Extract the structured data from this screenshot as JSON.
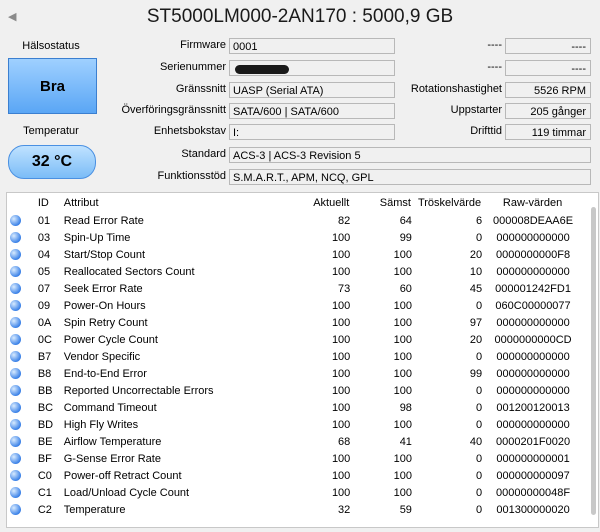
{
  "header": {
    "title": "ST5000LM000-2AN170 : 5000,9 GB",
    "prev_glyph": "◀"
  },
  "health": {
    "label": "Hälsostatus",
    "value": "Bra"
  },
  "temperature": {
    "label": "Temperatur",
    "value": "32 °C"
  },
  "fields": {
    "firmware": {
      "label": "Firmware",
      "value": "0001"
    },
    "serial": {
      "label": "Serienummer",
      "value": ""
    },
    "interface": {
      "label": "Gränssnitt",
      "value": "UASP (Serial ATA)"
    },
    "transfer": {
      "label": "Överföringsgränssnitt",
      "value": "SATA/600 | SATA/600"
    },
    "drive_letter": {
      "label": "Enhetsbokstav",
      "value": "I:"
    },
    "standard": {
      "label": "Standard",
      "value": "ACS-3 | ACS-3 Revision 5"
    },
    "features": {
      "label": "Funktionsstöd",
      "value": "S.M.A.R.T., APM, NCQ, GPL"
    }
  },
  "right_fields": {
    "blank1": {
      "label": "----",
      "value": "----"
    },
    "blank2": {
      "label": "----",
      "value": "----"
    },
    "rotation": {
      "label": "Rotationshastighet",
      "value": "5526 RPM"
    },
    "power_on_count": {
      "label": "Uppstarter",
      "value": "205 gånger"
    },
    "power_on_hours": {
      "label": "Drifttid",
      "value": "119 timmar"
    }
  },
  "table": {
    "headers": [
      "",
      "ID",
      "Attribut",
      "Aktuellt",
      "Sämst",
      "Tröskelvärde",
      "Raw-värden"
    ],
    "rows": [
      [
        "01",
        "Read Error Rate",
        "82",
        "64",
        "6",
        "000008DEAA6E"
      ],
      [
        "03",
        "Spin-Up Time",
        "100",
        "99",
        "0",
        "000000000000"
      ],
      [
        "04",
        "Start/Stop Count",
        "100",
        "100",
        "20",
        "0000000000F8"
      ],
      [
        "05",
        "Reallocated Sectors Count",
        "100",
        "100",
        "10",
        "000000000000"
      ],
      [
        "07",
        "Seek Error Rate",
        "73",
        "60",
        "45",
        "000001242FD1"
      ],
      [
        "09",
        "Power-On Hours",
        "100",
        "100",
        "0",
        "060C00000077"
      ],
      [
        "0A",
        "Spin Retry Count",
        "100",
        "100",
        "97",
        "000000000000"
      ],
      [
        "0C",
        "Power Cycle Count",
        "100",
        "100",
        "20",
        "0000000000CD"
      ],
      [
        "B7",
        "Vendor Specific",
        "100",
        "100",
        "0",
        "000000000000"
      ],
      [
        "B8",
        "End-to-End Error",
        "100",
        "100",
        "99",
        "000000000000"
      ],
      [
        "BB",
        "Reported Uncorrectable Errors",
        "100",
        "100",
        "0",
        "000000000000"
      ],
      [
        "BC",
        "Command Timeout",
        "100",
        "98",
        "0",
        "001200120013"
      ],
      [
        "BD",
        "High Fly Writes",
        "100",
        "100",
        "0",
        "000000000000"
      ],
      [
        "BE",
        "Airflow Temperature",
        "68",
        "41",
        "40",
        "0000201F0020"
      ],
      [
        "BF",
        "G-Sense Error Rate",
        "100",
        "100",
        "0",
        "000000000001"
      ],
      [
        "C0",
        "Power-off Retract Count",
        "100",
        "100",
        "0",
        "000000000097"
      ],
      [
        "C1",
        "Load/Unload Cycle Count",
        "100",
        "100",
        "0",
        "00000000048F"
      ],
      [
        "C2",
        "Temperature",
        "32",
        "59",
        "0",
        "001300000020"
      ]
    ]
  },
  "colors": {
    "good": "#5aa6f5",
    "dot": "#3b82e8"
  }
}
